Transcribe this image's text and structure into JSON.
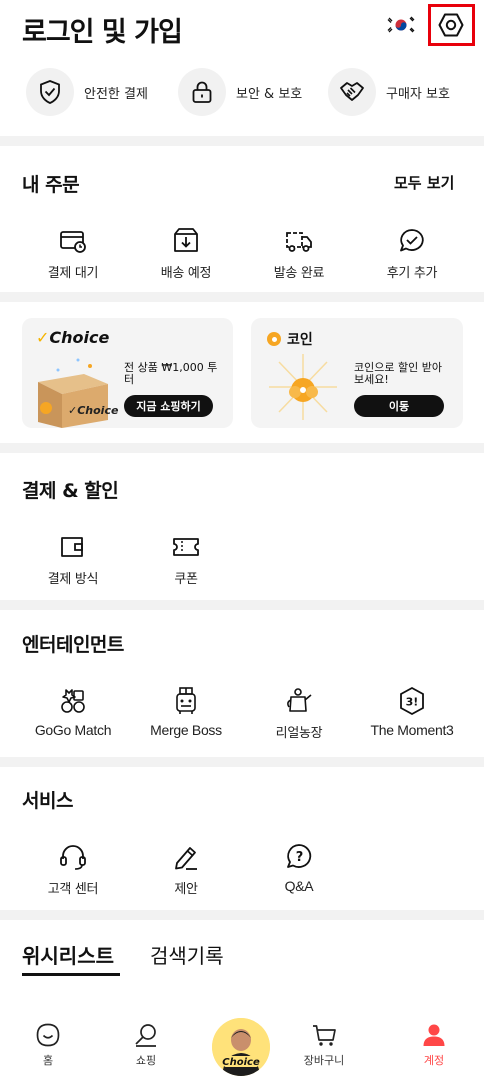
{
  "header": {
    "title": "로그인 및 가입"
  },
  "trust": [
    {
      "label": "안전한 결제",
      "icon": "shield-check-icon"
    },
    {
      "label": "보안 & 보호",
      "icon": "lock-icon"
    },
    {
      "label": "구매자 보호",
      "icon": "handshake-icon"
    }
  ],
  "orders": {
    "title": "내 주문",
    "view_all": "모두 보기",
    "items": [
      {
        "label": "결제 대기",
        "icon": "payment-pending-icon"
      },
      {
        "label": "배송 예정",
        "icon": "box-download-icon"
      },
      {
        "label": "발송 완료",
        "icon": "truck-icon"
      },
      {
        "label": "후기 추가",
        "icon": "review-chat-icon"
      }
    ]
  },
  "promo": {
    "choice_brand": "Choice",
    "choice_desc": "전 상품 ₩1,000 투터",
    "choice_button": "지금 쇼핑하기",
    "coin_title": "코인",
    "coin_desc": "코인으로 할인 받아보세요!",
    "coin_button": "이동"
  },
  "payment": {
    "title": "결제 & 할인",
    "items": [
      {
        "label": "결제 방식",
        "icon": "wallet-icon"
      },
      {
        "label": "쿠폰",
        "icon": "coupon-icon"
      }
    ]
  },
  "entertainment": {
    "title": "엔터테인먼트",
    "items": [
      {
        "label": "GoGo Match",
        "icon": "gogo-match-icon"
      },
      {
        "label": "Merge Boss",
        "icon": "merge-boss-icon"
      },
      {
        "label": "리얼농장",
        "icon": "watering-can-icon"
      },
      {
        "label": "The Moment3",
        "icon": "moment3-icon"
      }
    ]
  },
  "service": {
    "title": "서비스",
    "items": [
      {
        "label": "고객 센터",
        "icon": "headset-icon"
      },
      {
        "label": "제안",
        "icon": "pencil-icon"
      },
      {
        "label": "Q&A",
        "icon": "question-bubble-icon"
      }
    ]
  },
  "tabs": [
    {
      "label": "위시리스트",
      "active": true
    },
    {
      "label": "검색기록",
      "active": false
    }
  ],
  "bottom_nav": [
    {
      "label": "홈",
      "icon": "home-icon"
    },
    {
      "label": "쇼핑",
      "icon": "shopping-search-icon"
    },
    {
      "label": "Choice",
      "icon": "choice-avatar"
    },
    {
      "label": "장바구니",
      "icon": "cart-icon"
    },
    {
      "label": "계정",
      "icon": "account-icon",
      "active": true
    }
  ],
  "colors": {
    "accent": "#ff4747",
    "highlight_box": "#e8000b",
    "choice_yellow": "#f5b400",
    "coin_orange": "#f6a623"
  }
}
